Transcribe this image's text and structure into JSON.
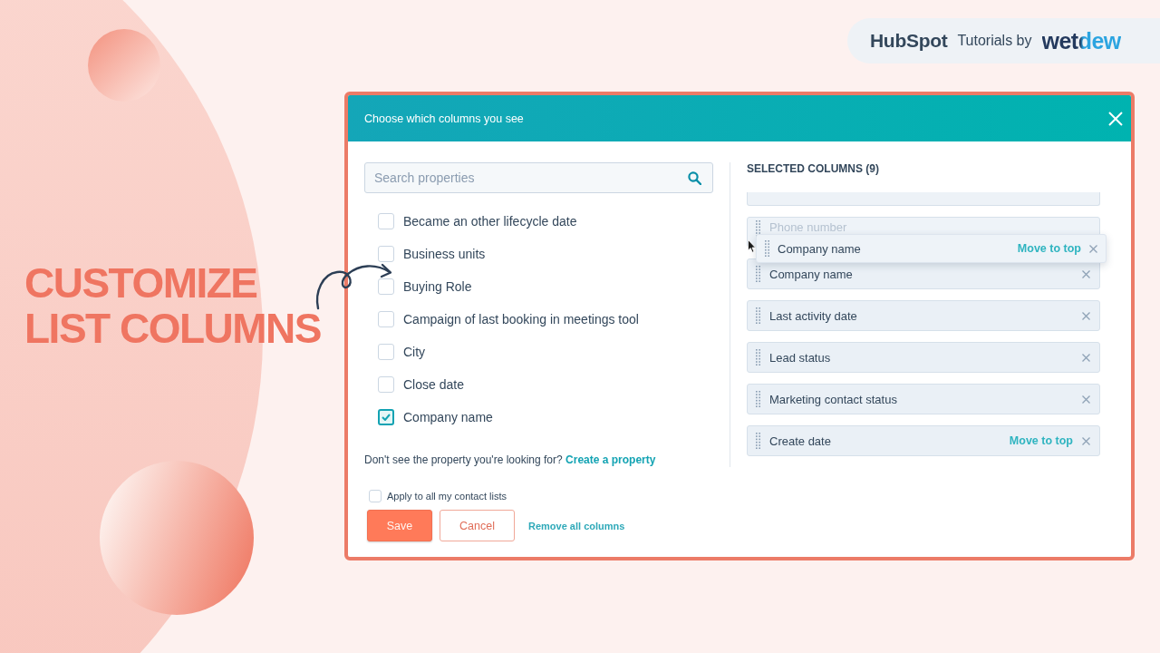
{
  "brand": {
    "logo": "HubSpot",
    "tagline": "Tutorials by",
    "partner": "wetdew"
  },
  "headline": [
    "CUSTOMIZE",
    "LIST COLUMNS"
  ],
  "dialog": {
    "title": "Choose which columns you see",
    "search": {
      "placeholder": "Search properties"
    },
    "properties": [
      {
        "label": "Became an other lifecycle date",
        "checked": false
      },
      {
        "label": "Business units",
        "checked": false
      },
      {
        "label": "Buying Role",
        "checked": false
      },
      {
        "label": "Campaign of last booking in meetings tool",
        "checked": false
      },
      {
        "label": "City",
        "checked": false
      },
      {
        "label": "Close date",
        "checked": false
      },
      {
        "label": "Company name",
        "checked": true
      }
    ],
    "hint": {
      "text": "Don't see the property you're looking for?",
      "link": "Create a property"
    },
    "selected_columns": {
      "heading": "SELECTED COLUMNS (9)",
      "items": [
        {
          "kind": "clipped"
        },
        {
          "kind": "placeholder",
          "label": "Phone number"
        },
        {
          "kind": "column",
          "label": "Company name"
        },
        {
          "kind": "column",
          "label": "Last activity date"
        },
        {
          "kind": "column",
          "label": "Lead status"
        },
        {
          "kind": "column",
          "label": "Marketing contact status"
        },
        {
          "kind": "column",
          "label": "Create date",
          "action": "Move to top"
        }
      ],
      "dragged": {
        "label": "Company name",
        "action": "Move to top"
      }
    },
    "apply_all": {
      "label": "Apply to all my contact lists",
      "checked": false
    },
    "buttons": [
      {
        "kind": "primary",
        "label": "Save"
      },
      {
        "kind": "secondary",
        "label": "Cancel"
      },
      {
        "kind": "link",
        "label": "Remove all columns"
      }
    ]
  }
}
